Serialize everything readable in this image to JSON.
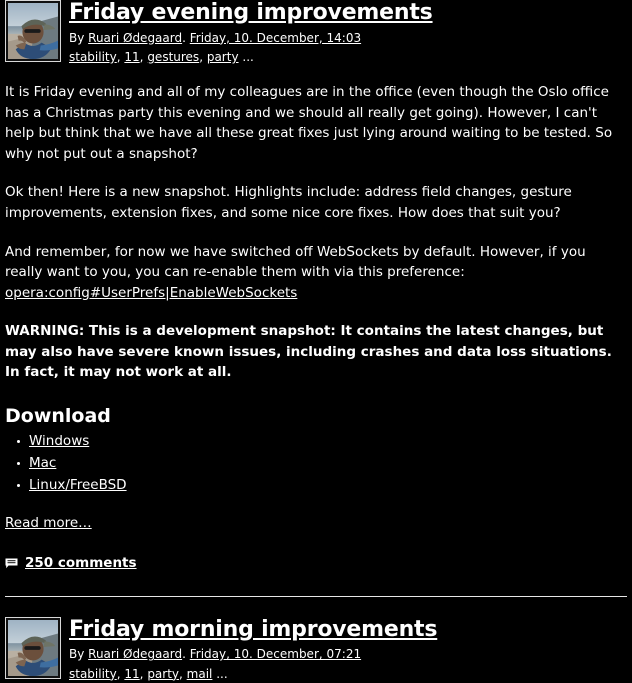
{
  "theme": {
    "background": "#000000",
    "text": "#ffffff",
    "link": "#ffffff",
    "rule": "#e6e6e6"
  },
  "posts": [
    {
      "title": "Friday evening improvements",
      "byline_prefix": "By ",
      "author": "Ruari Ødegaard",
      "byline_separator": ". ",
      "date": "Friday, 10. December, 14:03",
      "tags": [
        "stability",
        "11",
        "gestures",
        "party"
      ],
      "tags_more": "...",
      "avatar_alt": "portrait-photo-of-man-in-cap-at-beach",
      "paragraphs": [
        {
          "style": "normal",
          "text": "It is Friday evening and all of my colleagues are in the office (even though the Oslo office has a Christmas party this evening and we should all really get going). However, I can't help but think that we have all these great fixes just lying around waiting to be tested. So why not put out a snapshot?"
        },
        {
          "style": "normal",
          "text": "Ok then! Here is a new snapshot. Highlights include: address field changes, gesture improvements, extension fixes, and some nice core fixes. How does that suit you?"
        }
      ],
      "websockets_paragraph": {
        "lead": "And remember, for now we have switched off WebSockets by default. However, if you really want to you, you can re-enable them with via this preference: ",
        "link": "opera:config#UserPrefs|EnableWebSockets"
      },
      "warning": "WARNING: This is a development snapshot: It contains the latest changes, but may also have severe known issues, including crashes and data loss situations. In fact, it may not work at all.",
      "download_heading": "Download",
      "download_links": [
        "Windows",
        "Mac",
        "Linux/FreeBSD"
      ],
      "read_more": "Read more…",
      "comments_icon": "speech-bubble-icon",
      "comments_label": "250 comments"
    },
    {
      "title": "Friday morning improvements",
      "byline_prefix": "By ",
      "author": "Ruari Ødegaard",
      "byline_separator": ". ",
      "date": "Friday, 10. December, 07:21",
      "tags": [
        "stability",
        "11",
        "party",
        "mail"
      ],
      "tags_more": "...",
      "avatar_alt": "portrait-photo-of-man-in-cap-at-beach"
    }
  ]
}
